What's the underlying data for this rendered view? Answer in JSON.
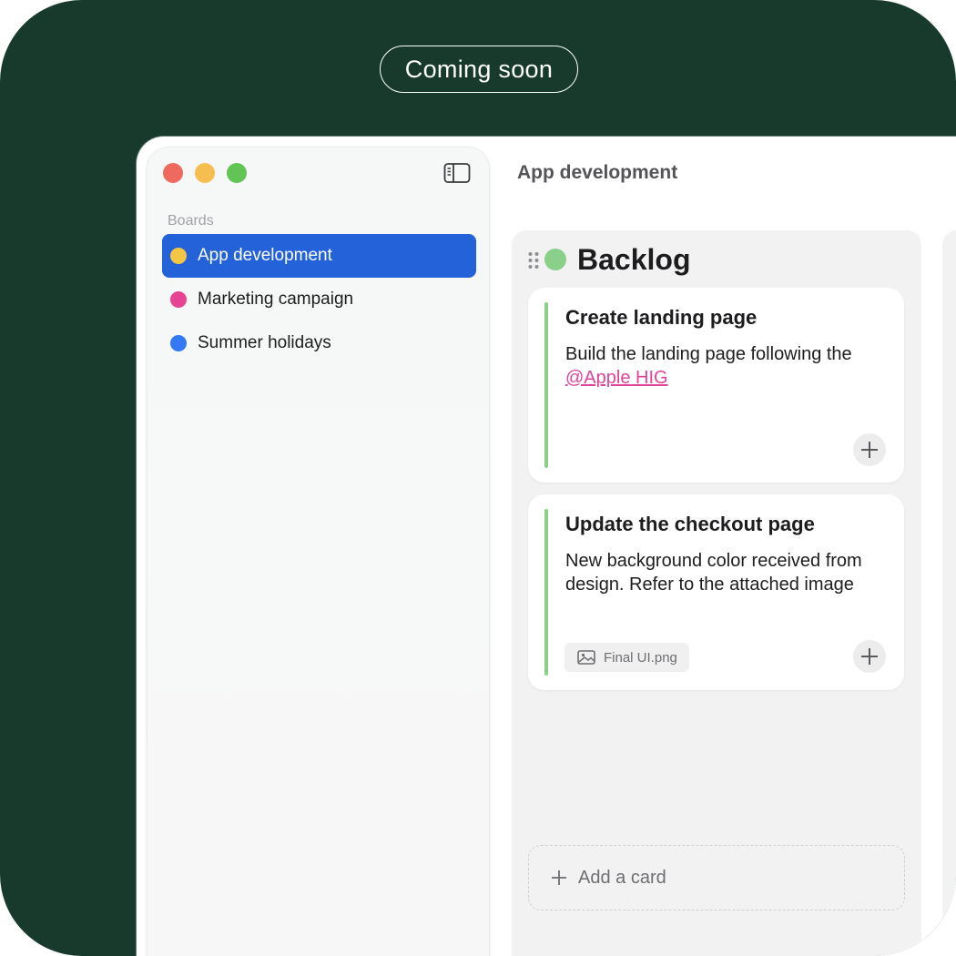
{
  "banner": {
    "label": "Coming soon"
  },
  "window": {
    "title": "App development"
  },
  "sidebar": {
    "section_label": "Boards",
    "items": [
      {
        "label": "App development",
        "color": "#f5c544",
        "active": true
      },
      {
        "label": "Marketing campaign",
        "color": "#e84393",
        "active": false
      },
      {
        "label": "Summer holidays",
        "color": "#3478f6",
        "active": false
      }
    ]
  },
  "column": {
    "title": "Backlog",
    "color": "#8ad08a",
    "cards": [
      {
        "title": "Create landing page",
        "description": "Build the landing page following the",
        "link": "@Apple HIG"
      },
      {
        "title": "Update the checkout page",
        "description": "New background color received from design. Refer to the attached image",
        "attachment": "Final UI.png"
      }
    ],
    "add_card_label": "Add a card"
  },
  "icons": {
    "traffic_lights": [
      "red",
      "yellow",
      "green"
    ],
    "sidebar_toggle": "sidebar-toggle-icon",
    "drag_handle": "drag-handle-icon",
    "card_add": "plus-icon",
    "attachment": "image-icon"
  }
}
